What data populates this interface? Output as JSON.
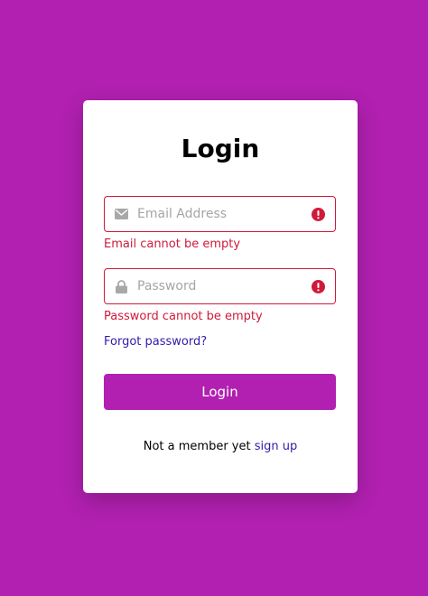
{
  "login_form": {
    "title": "Login",
    "email": {
      "value": "",
      "placeholder": "Email Address",
      "icon": "envelope-icon",
      "error": "Email cannot be empty"
    },
    "password": {
      "value": "",
      "placeholder": "Password",
      "icon": "lock-icon",
      "error": "Password cannot be empty"
    },
    "forgot_label": "Forgot password?",
    "submit_label": "Login",
    "signup_prompt": "Not a member yet",
    "signup_label": "sign up"
  },
  "colors": {
    "background": "#b120b0",
    "primary_button": "#b120b0",
    "error": "#d01a3a",
    "link": "#2f1da8",
    "card": "#ffffff"
  }
}
